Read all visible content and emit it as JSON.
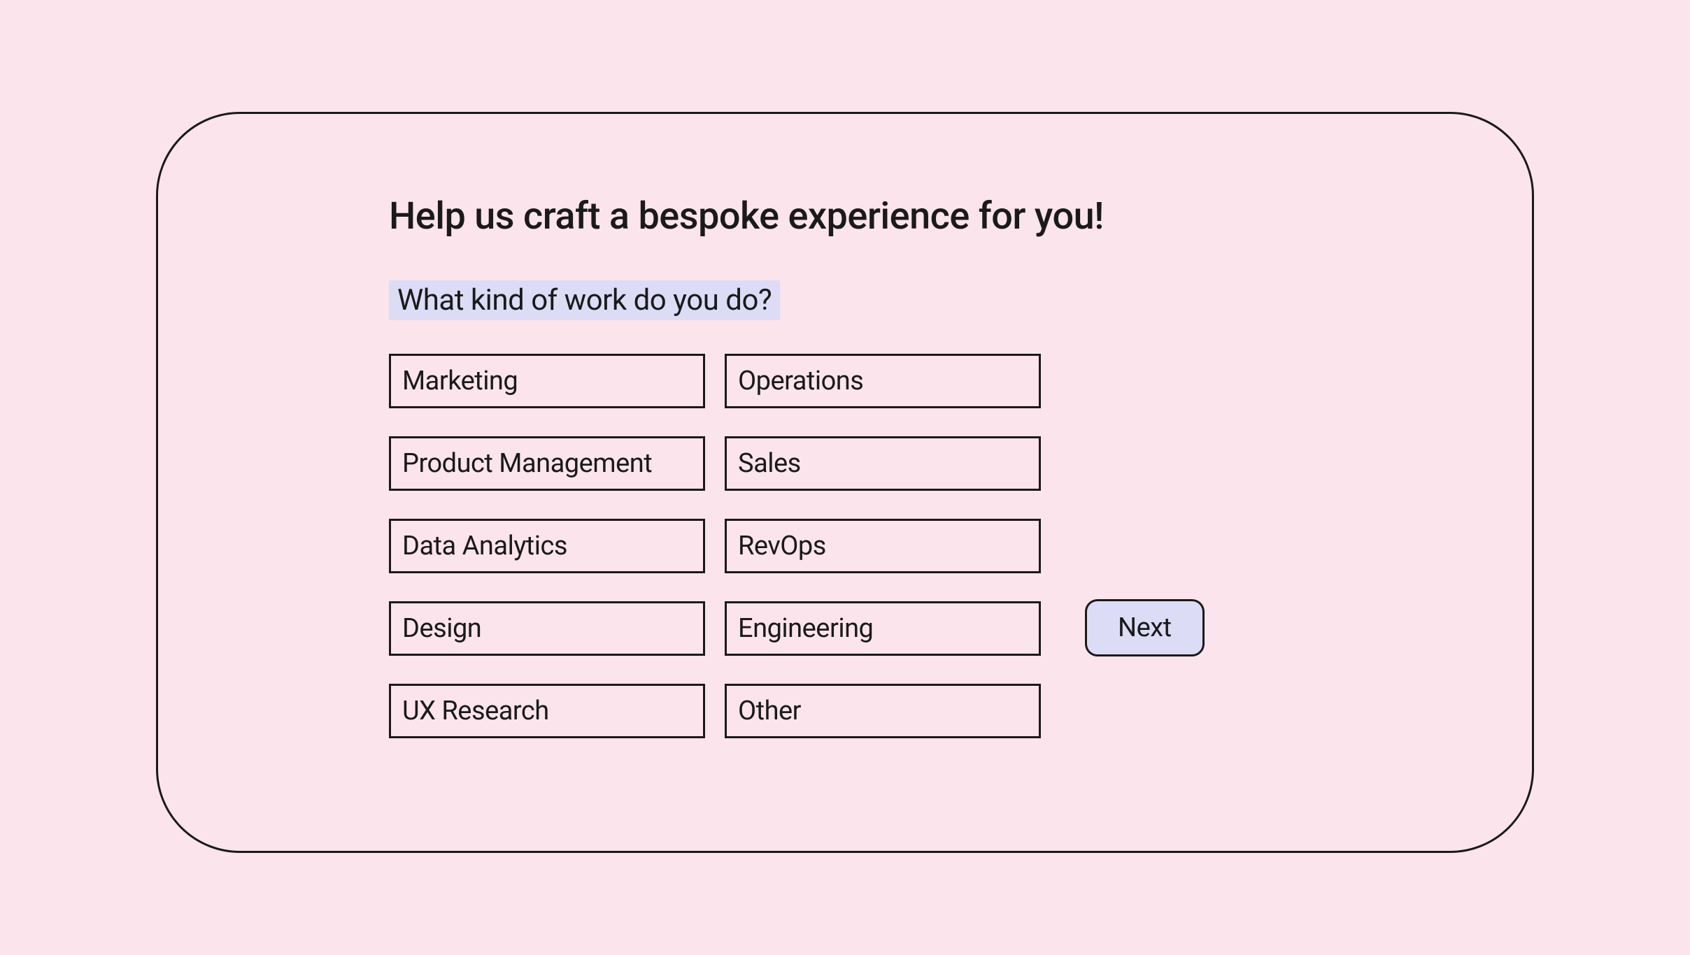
{
  "heading": "Help us craft a bespoke experience for you!",
  "question": "What kind of work do you do?",
  "options": {
    "col1": [
      "Marketing",
      "Product Management",
      "Data Analytics",
      "Design",
      "UX Research"
    ],
    "col2": [
      "Operations",
      "Sales",
      "RevOps",
      "Engineering",
      "Other"
    ]
  },
  "next_label": "Next"
}
